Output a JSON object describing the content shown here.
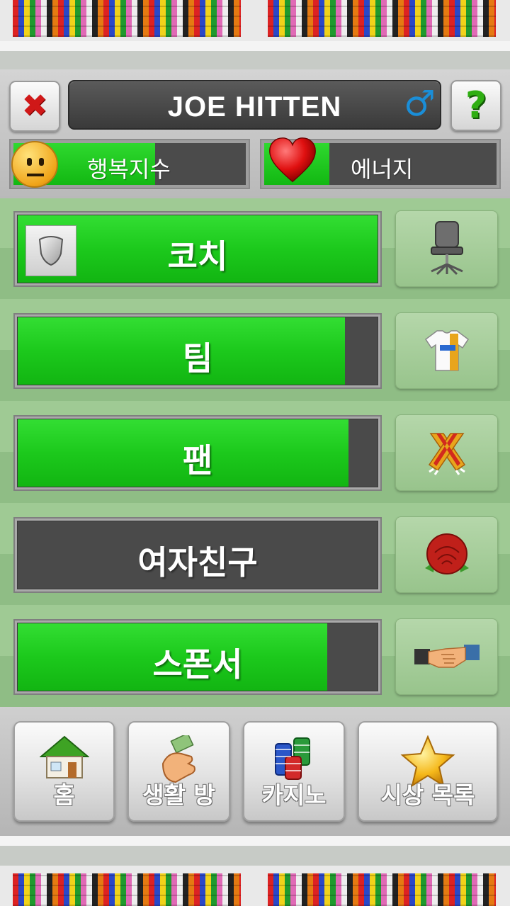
{
  "player": {
    "name": "JOE HITTEN",
    "gender_symbol": "♂"
  },
  "header": {
    "close_glyph": "✖",
    "help_glyph": "?"
  },
  "stats": {
    "happiness": {
      "label": "행복지수",
      "level": 0.61,
      "icon": "neutral-face-icon"
    },
    "energy": {
      "label": "에너지",
      "level": 0.28,
      "icon": "heart-icon"
    }
  },
  "relations": [
    {
      "key": "coach",
      "label": "코치",
      "level": 1.0,
      "icon": "office-chair-icon"
    },
    {
      "key": "team",
      "label": "팀",
      "level": 0.91,
      "icon": "jersey-icon"
    },
    {
      "key": "fans",
      "label": "팬",
      "level": 0.92,
      "icon": "scarf-icon"
    },
    {
      "key": "girlfriend",
      "label": "여자친구",
      "level": 0.0,
      "icon": "rose-icon"
    },
    {
      "key": "sponsor",
      "label": "스폰서",
      "level": 0.86,
      "icon": "handshake-icon"
    }
  ],
  "nav": [
    {
      "key": "home",
      "label": "홈",
      "icon": "house-icon"
    },
    {
      "key": "lifestyle",
      "label": "생활 방",
      "icon": "money-hand-icon"
    },
    {
      "key": "casino",
      "label": "카지노",
      "icon": "casino-chips-icon"
    },
    {
      "key": "awards",
      "label": "시상 목록",
      "icon": "star-icon"
    }
  ],
  "colors": {
    "bar_fill": "#1cc91c",
    "bar_empty": "#4a4a4a",
    "gender": "#1a8ed8",
    "close": "#d01818",
    "help": "#2fae12"
  }
}
